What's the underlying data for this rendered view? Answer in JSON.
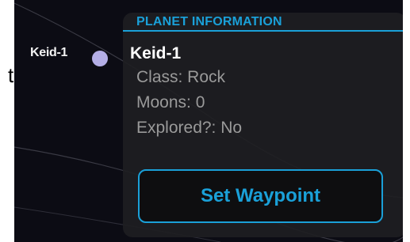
{
  "edge_glyph": "t",
  "map": {
    "planet_label": "Keid-1"
  },
  "info_panel": {
    "header": "PLANET INFORMATION",
    "name": "Keid-1",
    "details": [
      {
        "label": "Class: Rock"
      },
      {
        "label": "Moons: 0"
      },
      {
        "label": "Explored?: No"
      }
    ],
    "action_label": "Set Waypoint"
  },
  "colors": {
    "accent": "#1aa0d8",
    "background": "#0c0c14",
    "panel": "#1e1e22",
    "planet_dot": "#b4aee6",
    "detail_text": "#9a9a9a"
  }
}
